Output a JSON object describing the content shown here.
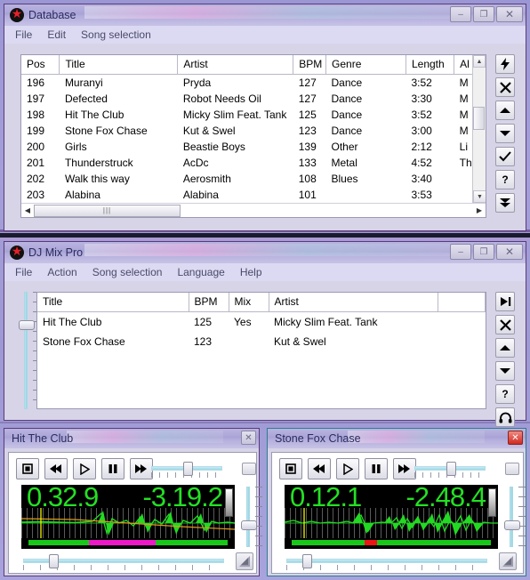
{
  "desktop": {
    "bg_color": "#a49fd8"
  },
  "windows": {
    "database": {
      "title": "Database",
      "icon": "red-star-icon",
      "active": false,
      "controls": {
        "minimize": "–",
        "maximize": "❐",
        "close": "✕"
      },
      "menu": [
        "File",
        "Edit",
        "Song selection"
      ],
      "table": {
        "columns": [
          "Pos",
          "Title",
          "Artist",
          "BPM",
          "Genre",
          "Length",
          "Al"
        ],
        "rows": [
          [
            "196",
            "Muranyi",
            "Pryda",
            "127",
            "Dance",
            "3:52",
            "M"
          ],
          [
            "197",
            "Defected",
            "Robot Needs Oil",
            "127",
            "Dance",
            "3:30",
            "M"
          ],
          [
            "198",
            "Hit The Club",
            "Micky Slim Feat. Tank",
            "125",
            "Dance",
            "3:52",
            "M"
          ],
          [
            "199",
            "Stone Fox Chase",
            "Kut & Swel",
            "123",
            "Dance",
            "3:00",
            "M"
          ],
          [
            "200",
            "Girls",
            "Beastie Boys",
            "139",
            "Other",
            "2:12",
            "Li"
          ],
          [
            "201",
            "Thunderstruck",
            "AcDc",
            "133",
            "Metal",
            "4:52",
            "Th"
          ],
          [
            "202",
            "Walk this way",
            "Aerosmith",
            "108",
            "Blues",
            "3:40",
            ""
          ],
          [
            "203",
            "Alabina",
            "Alabina",
            "101",
            "",
            "3:53",
            ""
          ]
        ]
      },
      "tools": [
        {
          "name": "lightning-icon",
          "glyph": "⚡"
        },
        {
          "name": "close-x-icon",
          "glyph": "✕"
        },
        {
          "name": "move-up-icon",
          "glyph": "▲"
        },
        {
          "name": "move-down-icon",
          "glyph": "▼"
        },
        {
          "name": "check-icon",
          "glyph": "✔"
        },
        {
          "name": "help-icon",
          "glyph": "?"
        },
        {
          "name": "double-down-icon",
          "glyph": "⯆"
        }
      ]
    },
    "djmixpro": {
      "title": "DJ Mix Pro",
      "icon": "red-star-icon",
      "active": false,
      "controls": {
        "minimize": "–",
        "maximize": "❐",
        "close": "✕"
      },
      "menu": [
        "File",
        "Action",
        "Song selection",
        "Language",
        "Help"
      ],
      "table": {
        "columns": [
          "Title",
          "BPM",
          "Mix",
          "Artist",
          ""
        ],
        "rows": [
          [
            "Hit The Club",
            "125",
            "Yes",
            "Micky Slim Feat. Tank",
            ""
          ],
          [
            "Stone Fox Chase",
            "123",
            "",
            "Kut & Swel",
            ""
          ]
        ]
      },
      "tools": [
        {
          "name": "skip-to-end-icon",
          "glyph": "▶|"
        },
        {
          "name": "close-x-icon",
          "glyph": "✕"
        },
        {
          "name": "move-up-icon",
          "glyph": "▲"
        },
        {
          "name": "move-down-icon",
          "glyph": "▼"
        },
        {
          "name": "help-icon",
          "glyph": "?"
        },
        {
          "name": "headphones-icon",
          "glyph": "🎧"
        }
      ],
      "crossfader": {
        "name": "vertical-crossfader",
        "value_pct": 28
      }
    },
    "player_left": {
      "title": "Hit The Club",
      "active": false,
      "close_label": "✕",
      "close_style": "gray",
      "transport": [
        {
          "name": "stop-button",
          "glyph": "■"
        },
        {
          "name": "rewind-button",
          "glyph": "◀◀"
        },
        {
          "name": "play-button",
          "glyph": "▶"
        },
        {
          "name": "pause-button",
          "glyph": "❚❚"
        },
        {
          "name": "fast-forward-button",
          "glyph": "▶▶"
        }
      ],
      "pitch_slider_pct": 52,
      "display": {
        "elapsed": "0.32.9",
        "remaining": "-3.19.2"
      },
      "volume_slider_pct": 58,
      "position_slider_pct": 14,
      "progress": {
        "played_pct": 32,
        "cue_pct": 31,
        "cue_width_pct": 33
      }
    },
    "player_right": {
      "title": "Stone Fox Chase",
      "active": true,
      "close_label": "✕",
      "close_style": "red",
      "transport": [
        {
          "name": "stop-button",
          "glyph": "■"
        },
        {
          "name": "rewind-button",
          "glyph": "◀◀"
        },
        {
          "name": "play-button",
          "glyph": "▶"
        },
        {
          "name": "pause-button",
          "glyph": "❚❚"
        },
        {
          "name": "fast-forward-button",
          "glyph": "▶▶"
        }
      ],
      "pitch_slider_pct": 52,
      "display": {
        "elapsed": "0.12.1",
        "remaining": "-2.48.4"
      },
      "volume_slider_pct": 58,
      "position_slider_pct": 9,
      "progress": {
        "played_pct": 96,
        "cue_pct": 39,
        "cue_width_pct": 6
      }
    }
  }
}
